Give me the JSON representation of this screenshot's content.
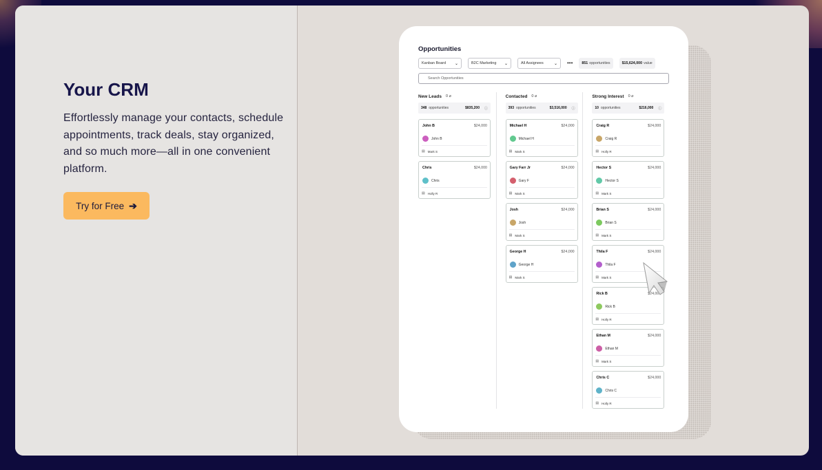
{
  "hero": {
    "title": "Your CRM",
    "description": "Effortlessly manage your contacts, schedule appointments, track deals, stay organized, and so much more—all in one convenient platform.",
    "cta_label": "Try for Free",
    "cta_arrow": "➔"
  },
  "colors": {
    "accent": "#fbb95f",
    "page_bg": "#0e0b3d",
    "title": "#17154a"
  },
  "crm": {
    "title": "Opportunities",
    "view_select": "Kanban Board",
    "pipeline_select": "B2C Marketing",
    "assignee_select": "All Assignees",
    "more": "•••",
    "total_count": "851",
    "total_count_label": "opportunities",
    "total_value": "$15,624,000",
    "total_value_label": "value",
    "search_placeholder": "Search Opportunities",
    "columns": [
      {
        "name": "New Leads",
        "count": "0",
        "summary_count": "348",
        "summary_label": "opportunities",
        "summary_value": "$835,200",
        "deals": [
          {
            "name": "John B",
            "amount": "$24,000",
            "contact": "John B",
            "color": "#cc5fbf",
            "owner": "Mark S"
          },
          {
            "name": "Chris",
            "amount": "$24,000",
            "contact": "Chris",
            "color": "#5fc0c9",
            "owner": "Holly R"
          }
        ]
      },
      {
        "name": "Contacted",
        "count": "0",
        "summary_count": "393",
        "summary_label": "opportunities",
        "summary_value": "$3,516,000",
        "deals": [
          {
            "name": "Michael H",
            "amount": "$24,000",
            "contact": "Michael H",
            "color": "#62c98f",
            "owner": "Mark S"
          },
          {
            "name": "Gary Farr Jr",
            "amount": "$24,000",
            "contact": "Gary F",
            "color": "#d45f6d",
            "owner": "Mark S"
          },
          {
            "name": "Josh",
            "amount": "$24,000",
            "contact": "Josh",
            "color": "#c8a668",
            "owner": "Mark S"
          },
          {
            "name": "George H",
            "amount": "$24,000",
            "contact": "George H",
            "color": "#5fa3c9",
            "owner": "Mark S"
          }
        ]
      },
      {
        "name": "Strong Interest",
        "count": "0",
        "summary_count": "10",
        "summary_label": "opportunities",
        "summary_value": "$216,000",
        "deals": [
          {
            "name": "Craig R",
            "amount": "$24,000",
            "contact": "Craig R",
            "color": "#c8a668",
            "owner": "Holly R"
          },
          {
            "name": "Hector S",
            "amount": "$24,000",
            "contact": "Hector S",
            "color": "#62c9a8",
            "owner": "Mark S"
          },
          {
            "name": "Brian S",
            "amount": "$24,000",
            "contact": "Brian S",
            "color": "#7cc95f",
            "owner": "Mark S"
          },
          {
            "name": "Thila F",
            "amount": "$24,000",
            "contact": "Thila F",
            "color": "#b35fcc",
            "owner": "Mark S"
          },
          {
            "name": "Rick B",
            "amount": "$24,000",
            "contact": "Rick B",
            "color": "#8ec95f",
            "owner": "Holly R"
          },
          {
            "name": "Ethan M",
            "amount": "$24,000",
            "contact": "Ethan M",
            "color": "#cc5fa6",
            "owner": "Mark S"
          },
          {
            "name": "Chris C",
            "amount": "$24,000",
            "contact": "Chris C",
            "color": "#5fb3c9",
            "owner": "Holly R"
          }
        ]
      }
    ]
  }
}
